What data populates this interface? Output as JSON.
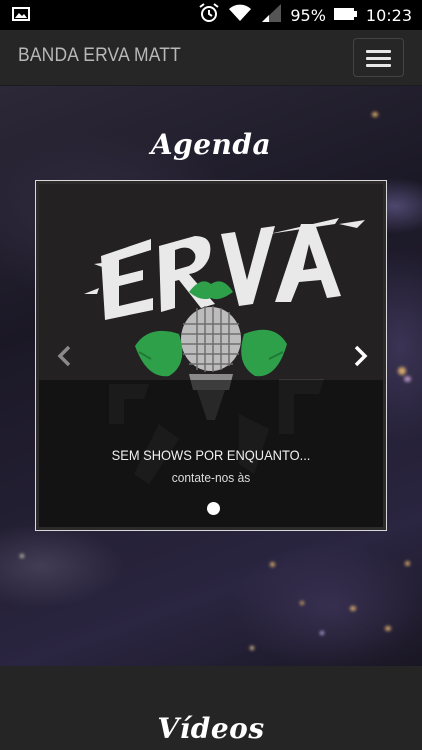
{
  "statusbar": {
    "battery_percent": "95%",
    "time": "10:23"
  },
  "navbar": {
    "brand": "BANDA ERVA MATT"
  },
  "agenda": {
    "title": "Agenda",
    "slide": {
      "caption_title": "SEM SHOWS POR ENQUANTO...",
      "caption_sub": "contate-nos às"
    },
    "indicators": 1,
    "active_indicator": 0
  },
  "videos": {
    "title": "Vídeos"
  },
  "colors": {
    "navbar_bg": "#262626",
    "leaf_green": "#2fa04a",
    "text_white": "#ffffff"
  },
  "icons": [
    "image-icon",
    "alarm-icon",
    "wifi-icon",
    "signal-icon",
    "battery-icon",
    "hamburger-icon",
    "chevron-left-icon",
    "chevron-right-icon",
    "microphone-icon"
  ]
}
